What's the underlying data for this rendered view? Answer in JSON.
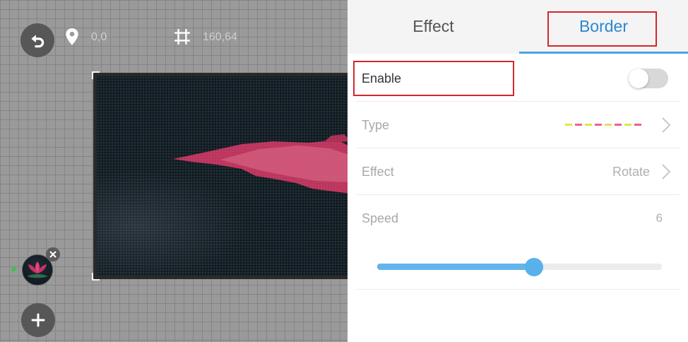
{
  "canvas": {
    "position_label": "0,0",
    "size_label": "160,64"
  },
  "tabs": [
    {
      "label": "Effect",
      "active": false
    },
    {
      "label": "Border",
      "active": true
    }
  ],
  "settings": {
    "enable": {
      "label": "Enable",
      "on": false
    },
    "type": {
      "label": "Type"
    },
    "effect": {
      "label": "Effect",
      "value": "Rotate"
    },
    "speed": {
      "label": "Speed",
      "value": "6",
      "fraction": 0.55
    }
  },
  "colors": {
    "accent": "#47a5e6",
    "highlight": "#d4262c",
    "slider": "#63b4ea"
  },
  "icons": {
    "undo": "undo-icon",
    "position": "map-pin-icon",
    "size": "crop-icon",
    "close": "close-icon",
    "add": "plus-icon",
    "chevron": "chevron-right-icon"
  }
}
